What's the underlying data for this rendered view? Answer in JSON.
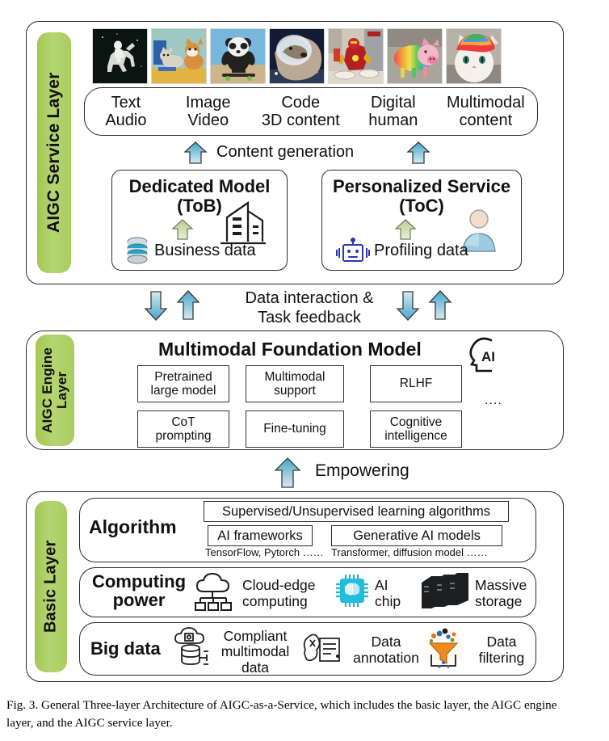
{
  "figure": {
    "caption": "Fig. 3.  General Three-layer Architecture of AIGC-as-a-Service, which includes the basic layer, the AIGC engine layer, and the AIGC service layer."
  },
  "colors": {
    "layer_label_green": "#a9cc5f",
    "arrow_blue": "#5cb3d2",
    "arrow_green": "#c2d79a",
    "panel_border": "#2b2b2b"
  },
  "service_layer": {
    "label": "AIGC Service Layer",
    "thumbnails": [
      {
        "name": "astronaut-riding-horse"
      },
      {
        "name": "cat-and-corgi-painting"
      },
      {
        "name": "panda-on-skateboard"
      },
      {
        "name": "dog-in-space-helmet"
      },
      {
        "name": "iron-man-cooking"
      },
      {
        "name": "rainbow-striped-pig"
      },
      {
        "name": "rainbow-hair-cat"
      }
    ],
    "output_pill": {
      "columns": [
        {
          "top": "Text",
          "bottom": "Audio"
        },
        {
          "top": "Image",
          "bottom": "Video"
        },
        {
          "top": "Code",
          "bottom": "3D content"
        },
        {
          "top": "Digital",
          "bottom": "human"
        },
        {
          "top": "Multimodal",
          "bottom": "content"
        }
      ]
    },
    "content_generation_label": "Content generation",
    "cards": [
      {
        "title": "Dedicated Model\n(ToB)",
        "data_label": "Business data",
        "data_icon": "database-icon",
        "entity_icon": "office-building-icon",
        "up_arrow": "green-up-arrow"
      },
      {
        "title": "Personalized Service\n(ToC)",
        "data_label": "Profiling data",
        "data_icon": "robot-icon",
        "entity_icon": "user-avatar-icon",
        "up_arrow": "green-up-arrow"
      }
    ]
  },
  "interlayer_top": {
    "label": "Data interaction &\nTask feedback",
    "arrows": [
      "down-arrow",
      "up-arrow",
      "down-arrow",
      "up-arrow"
    ]
  },
  "engine_layer": {
    "label": "AIGC Engine\nLayer",
    "title": "Multimodal Foundation Model",
    "badge_icon": "ai-head-icon",
    "badge_text": "AI",
    "boxes_row1": [
      "Pretrained\nlarge model",
      "Multimodal\nsupport",
      "RLHF"
    ],
    "boxes_row2": [
      "CoT\nprompting",
      "Fine-tuning",
      "Cognitive\nintelligence"
    ],
    "ellipsis": "...."
  },
  "interlayer_bottom": {
    "label": "Empowering",
    "arrow": "up-arrow"
  },
  "basic_layer": {
    "label": "Basic Layer",
    "sections": [
      {
        "title": "Algorithm",
        "wide_box": "Supervised/Unsupervised learning algorithms",
        "boxes": [
          "AI frameworks",
          "Generative AI models"
        ],
        "footnotes": [
          "TensorFlow, Pytorch ……",
          "Transformer,  diffusion model ……"
        ]
      },
      {
        "title": "Computing\npower",
        "items": [
          {
            "icon": "cloud-edge-icon",
            "label": "Cloud-edge\ncomputing"
          },
          {
            "icon": "ai-chip-icon",
            "label": "AI\nchip"
          },
          {
            "icon": "server-rack-icon",
            "label": "Massive\nstorage"
          }
        ]
      },
      {
        "title": "Big data",
        "items": [
          {
            "icon": "cloud-database-icon",
            "label": "Compliant\nmultimodal\ndata"
          },
          {
            "icon": "annotation-icon",
            "label": "Data\nannotation"
          },
          {
            "icon": "funnel-filter-icon",
            "label": "Data\nfiltering"
          }
        ]
      }
    ]
  }
}
